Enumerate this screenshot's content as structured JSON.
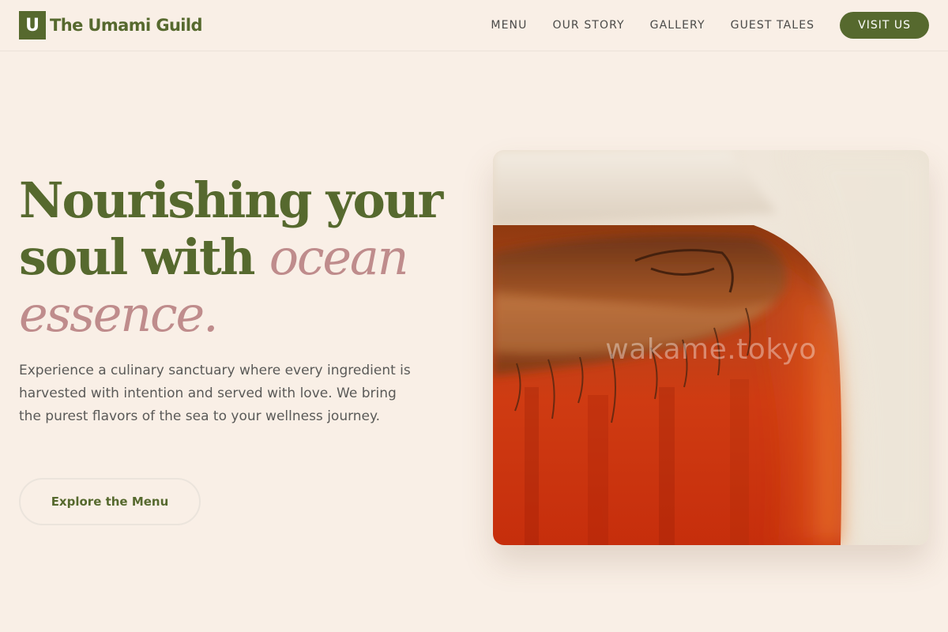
{
  "brand": {
    "mark": "U",
    "name": "The Umami Guild",
    "accent_color": "#56692e"
  },
  "nav": {
    "items": [
      "MENU",
      "OUR STORY",
      "GALLERY",
      "GUEST TALES"
    ],
    "cta_label": "VISIT US"
  },
  "hero": {
    "title_part1": "Nourishing your soul with ",
    "title_accent": "ocean essence.",
    "accent_color": "#bf8c8c",
    "description": "Experience a culinary sanctuary where every ingredient is harvested with intention and served with love. We bring the purest flavors of the sea to your wellness journey.",
    "cta_label": "Explore the Menu"
  },
  "image": {
    "watermark": "wakame.tokyo"
  }
}
